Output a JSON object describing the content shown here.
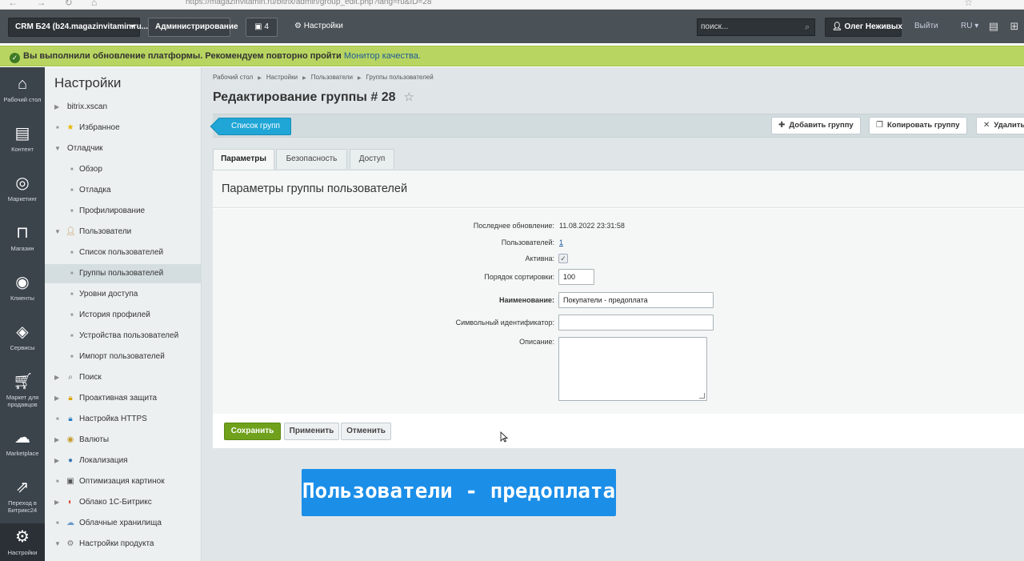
{
  "browser": {
    "nav_icons": "← → ↻ ⌂",
    "url": "https://magazinvitamin.ru/bitrix/admin/group_edit.php?lang=ru&ID=28"
  },
  "admin_panel": {
    "site_label": "CRM Б24 (b24.magazinvitamin.ru...",
    "admin_label": "Администрирование",
    "count": "4",
    "settings_label": "Настройки",
    "search_placeholder": "поиск...",
    "user_name": "Олег Неживых",
    "exit_label": "Выйти",
    "lang_label": "RU"
  },
  "notice": {
    "text": "Вы выполнили обновление платформы. Рекомендуем повторно пройти",
    "link": "Монитор качества."
  },
  "rail": [
    {
      "label": "Рабочий стол",
      "icon": "home-icon"
    },
    {
      "label": "Контент",
      "icon": "content-icon"
    },
    {
      "label": "Маркетинг",
      "icon": "target-icon"
    },
    {
      "label": "Магазин",
      "icon": "basket-icon"
    },
    {
      "label": "Клиенты",
      "icon": "clients-icon"
    },
    {
      "label": "Сервисы",
      "icon": "layers-icon"
    },
    {
      "label": "Маркет для продавцов",
      "icon": "cart-icon"
    },
    {
      "label": "Marketplace",
      "icon": "cloud-icon"
    },
    {
      "label": "Переход в Битрикс24",
      "icon": "transition-icon"
    },
    {
      "label": "Настройки",
      "icon": "gear-icon"
    }
  ],
  "menu": {
    "title": "Настройки",
    "items": [
      {
        "label": "bitrix.xscan"
      },
      {
        "label": "Избранное"
      },
      {
        "label": "Отладчик"
      },
      {
        "label": "Обзор"
      },
      {
        "label": "Отладка"
      },
      {
        "label": "Профилирование"
      },
      {
        "label": "Пользователи"
      },
      {
        "label": "Список пользователей"
      },
      {
        "label": "Группы пользователей"
      },
      {
        "label": "Уровни доступа"
      },
      {
        "label": "История профилей"
      },
      {
        "label": "Устройства пользователей"
      },
      {
        "label": "Импорт пользователей"
      },
      {
        "label": "Поиск"
      },
      {
        "label": "Проактивная защита"
      },
      {
        "label": "Настройка HTTPS"
      },
      {
        "label": "Валюты"
      },
      {
        "label": "Локализация"
      },
      {
        "label": "Оптимизация картинок"
      },
      {
        "label": "Облако 1С-Битрикс"
      },
      {
        "label": "Облачные хранилища"
      },
      {
        "label": "Настройки продукта"
      }
    ]
  },
  "breadcrumbs": [
    "Рабочий стол",
    "Настройки",
    "Пользователи",
    "Группы пользователей"
  ],
  "page_title": "Редактирование группы # 28",
  "toolbar": {
    "back_label": "Список групп",
    "add_label": "Добавить группу",
    "copy_label": "Копировать группу",
    "delete_label": "Удалить"
  },
  "tabs": [
    "Параметры",
    "Безопасность",
    "Доступ"
  ],
  "panel_title": "Параметры группы пользователей",
  "form": {
    "updated_label": "Последнее обновление:",
    "updated_value": "11.08.2022 23:31:58",
    "users_label": "Пользователей:",
    "users_value": "1",
    "active_label": "Активна:",
    "active_checked": true,
    "sort_label": "Порядок сортировки:",
    "sort_value": "100",
    "name_label": "Наименование:",
    "name_value": "Покупатели - предоплата",
    "code_label": "Символьный идентификатор:",
    "code_value": "",
    "desc_label": "Описание:",
    "desc_value": ""
  },
  "buttons": {
    "save": "Сохранить",
    "apply": "Применить",
    "cancel": "Отменить"
  },
  "caption": "Пользователи - предоплата",
  "colors": {
    "admin_bar": "#4a5157",
    "notice": "#b8d561",
    "accent_blue": "#1fa6d6",
    "save_green": "#70a11c",
    "caption_blue": "#1b8ee8"
  }
}
